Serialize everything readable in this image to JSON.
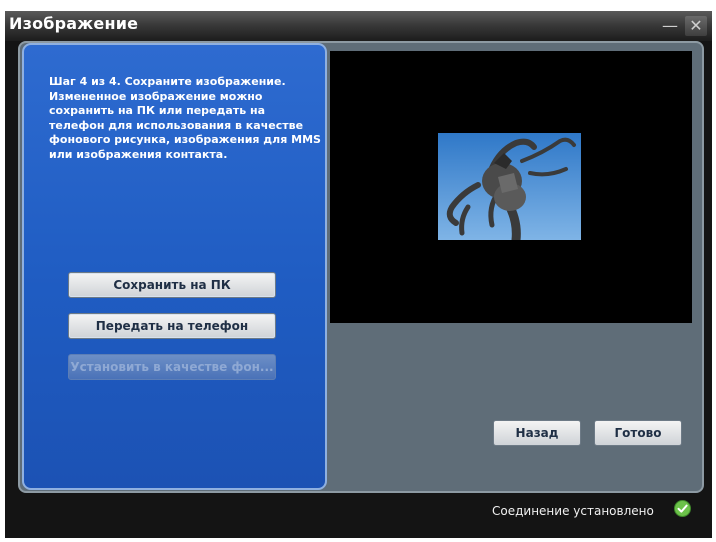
{
  "window": {
    "title": "Изображение",
    "minimize_glyph": "—",
    "close_glyph": "✕"
  },
  "instructions": "Шаг 4 из 4. Сохраните изображение. Измененное изображение можно сохранить на ПК или передать на телефон для использования в качестве фонового рисунка, изображения для MMS или изображения контакта.",
  "actions": {
    "save_pc": "Сохранить на ПК",
    "send_phone": "Передать на телефон",
    "set_wallpaper": "Установить в качестве фон..."
  },
  "nav": {
    "back": "Назад",
    "done": "Готово"
  },
  "status": {
    "text": "Соединение установлено",
    "icon": "check-circle-icon",
    "color": "#6cc24a"
  },
  "colors": {
    "left_panel": "#1f5cc2",
    "content_bg": "#5f6d78",
    "window_bg": "#141414"
  }
}
